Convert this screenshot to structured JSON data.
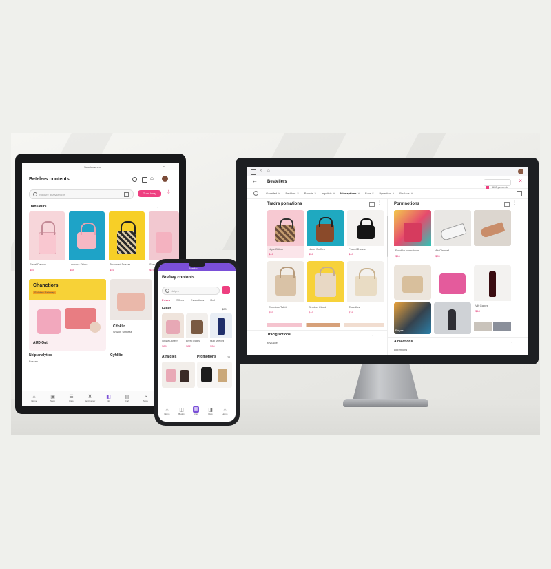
{
  "monitor": {
    "title": "Bestellers",
    "badge": "600 percents",
    "filters": [
      "Gaseffed",
      "Beddors",
      "Proods",
      "Ingetists",
      "Minnaptions",
      "Euvr",
      "Bysestion",
      "Bealads"
    ],
    "left_section": "Tradrs pomations",
    "right_section": "Pormnotions",
    "bottom_left": "Tracig sotions",
    "bottom_left_sub": "toyTacte",
    "bottom_right": "Airaactions",
    "bottom_right_sub": "Lippmtions",
    "left_items": [
      {
        "name": "Ntyle Ditton",
        "price": "$46"
      },
      {
        "name": "Nsnel Daffies",
        "price": "$56"
      },
      {
        "name": "Pneed Dwaner",
        "price": "$48"
      },
      {
        "name": "Cnnoiorc Tabtt",
        "price": "$55"
      },
      {
        "name": "Sinrdan Cinod",
        "price": "$46"
      },
      {
        "name": "Tbecdlos",
        "price": "$38"
      }
    ],
    "right_items": [
      {
        "name": "Fnod Isuoomnhions",
        "price": "$66"
      },
      {
        "name": "Air Clnonef",
        "price": "$35"
      },
      {
        "name": "Fbiyas",
        "price": "$69"
      },
      {
        "name": "Vllt Gapes",
        "price": "$48"
      }
    ],
    "colors": {
      "accent": "#ee3f80",
      "purple": "#7b4fd6"
    }
  },
  "tablet": {
    "title": "Betelers contents",
    "top_label": "Sessionsmen",
    "search_placeholder": "Ndjoyre analysenicns",
    "action_button": "Guinf lomy",
    "section": "Transaturs",
    "items": [
      {
        "name": "Srsial Daiobe",
        "price": "$55"
      },
      {
        "name": "Lnreasa Diliers",
        "price": "$58"
      },
      {
        "name": "Trcoosed Dosser",
        "price": "$46"
      },
      {
        "name": "Soeu",
        "price": "$49"
      }
    ],
    "promo_title": "Chanctiors",
    "promo_sub": "Soluten Reianay",
    "promo_caption": "AUD Out",
    "promo2_title": "Clfoklin",
    "promo2_sub": "Wuzor, Ulitnese",
    "bottom_left": "Nelp analytics",
    "bottom_left_sub": "Bosses",
    "bottom_right": "Cyfdiliz",
    "nav": [
      "Home",
      "Shop",
      "Lists",
      "Bentresmer",
      "Info",
      "Cart",
      "More",
      "User"
    ]
  },
  "phone": {
    "status": "Beeltar",
    "title": "Breffey contents",
    "search_placeholder": "Nelpro",
    "tabs": [
      "Prises",
      "Sffercr",
      "Evanstions",
      "Roll"
    ],
    "section": "Fellat",
    "section_count": "$20",
    "items": [
      {
        "name": "Cirdae Daneer",
        "price": "$29"
      },
      {
        "name": "Bnreo Daiies",
        "price": "$22"
      },
      {
        "name": "Hulp Mrecies",
        "price": "$30"
      }
    ],
    "section2": "Atraidies",
    "section3": "Promotions",
    "section3_count": "23",
    "nav": [
      "Home",
      "Beddy",
      "Entor",
      "Diap",
      "Home"
    ]
  }
}
